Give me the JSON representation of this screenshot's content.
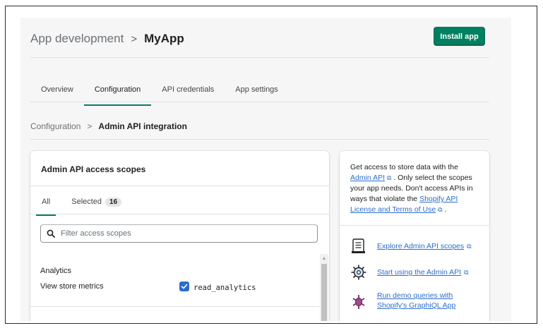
{
  "header": {
    "breadcrumb_root": "App development",
    "breadcrumb_separator": ">",
    "breadcrumb_current": "MyApp",
    "install_button": "Install app",
    "accent_color": "#008060"
  },
  "tabs": [
    {
      "label": "Overview",
      "active": false
    },
    {
      "label": "Configuration",
      "active": true
    },
    {
      "label": "API credentials",
      "active": false
    },
    {
      "label": "App settings",
      "active": false
    }
  ],
  "sub_breadcrumb": {
    "root": "Configuration",
    "separator": ">",
    "current": "Admin API integration"
  },
  "scopes_card": {
    "title": "Admin API access scopes",
    "tabs": [
      {
        "label": "All",
        "active": true
      },
      {
        "label": "Selected",
        "count": "16",
        "active": false
      }
    ],
    "search_placeholder": "Filter access scopes",
    "groups": [
      {
        "title": "Analytics",
        "scopes": [
          {
            "label": "View store metrics",
            "code": "read_analytics",
            "checked": true
          }
        ]
      }
    ]
  },
  "info_card": {
    "text_1": "Get access to store data with the",
    "link_admin_api": "Admin API",
    "text_2": ". Only select the scopes your app needs. Don't access APIs in ways that violate the",
    "link_license": "Shopify API License and Terms of Use",
    "text_3": ".",
    "resources": [
      {
        "label": "Explore Admin API scopes",
        "icon": "document-icon"
      },
      {
        "label": "Start using the Admin API",
        "icon": "gear-icon"
      },
      {
        "label": "Run demo queries with Shopify's GraphiQL App",
        "icon": "bug-icon"
      }
    ]
  }
}
